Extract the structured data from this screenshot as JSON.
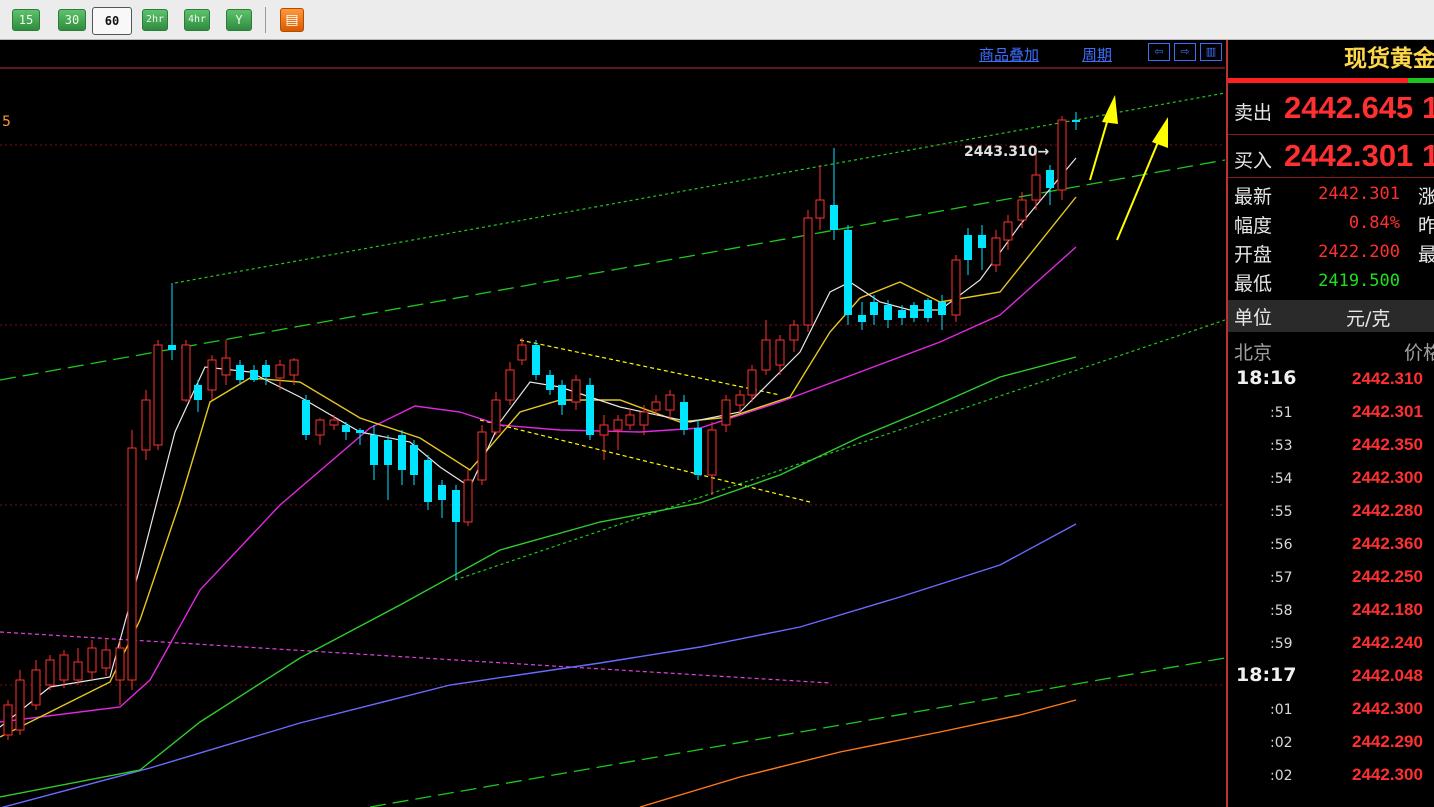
{
  "toolbar": {
    "buttons": [
      {
        "label": "15",
        "active": false
      },
      {
        "label": "30",
        "active": false
      },
      {
        "label": "60",
        "active": true
      },
      {
        "label": "2hr",
        "active": false
      },
      {
        "label": "4hr",
        "active": false
      },
      {
        "label": "Y",
        "active": false
      }
    ],
    "kline_icon": "k-chart-icon"
  },
  "chart": {
    "overlay_link": "商品叠加",
    "period_link": "周期",
    "nav_icons": [
      "arrow-left-icon",
      "arrow-right-icon",
      "panel-layout-icon"
    ],
    "ma_label": "5",
    "price_annotation": "2443.310→",
    "colors": {
      "up": "#ff3030",
      "down": "#00e5ff",
      "background": "#000000"
    }
  },
  "panel": {
    "title": "现货黄金",
    "sell_label": "卖出",
    "sell_price": "2442.645",
    "sell_extra": "1",
    "buy_label": "买入",
    "buy_price": "2442.301",
    "buy_extra": "1",
    "info": [
      {
        "label": "最新",
        "value": "2442.301",
        "color": "#ff3030",
        "label2": "涨"
      },
      {
        "label": "幅度",
        "value": "0.84%",
        "color": "#ff3030",
        "label2": "昨"
      },
      {
        "label": "开盘",
        "value": "2422.200",
        "color": "#ff3030",
        "label2": "最"
      },
      {
        "label": "最低",
        "value": "2419.500",
        "color": "#1ee01e",
        "label2": ""
      }
    ],
    "unit_label": "单位",
    "unit_value": "元/克",
    "city": "北京",
    "price_col": "价格",
    "ticks": [
      {
        "time": "18:16",
        "price": "2442.310",
        "big": true
      },
      {
        "time": ":51",
        "price": "2442.301",
        "big": false
      },
      {
        "time": ":53",
        "price": "2442.350",
        "big": false
      },
      {
        "time": ":54",
        "price": "2442.300",
        "big": false
      },
      {
        "time": ":55",
        "price": "2442.280",
        "big": false
      },
      {
        "time": ":56",
        "price": "2442.360",
        "big": false
      },
      {
        "time": ":57",
        "price": "2442.250",
        "big": false
      },
      {
        "time": ":58",
        "price": "2442.180",
        "big": false
      },
      {
        "time": ":59",
        "price": "2442.240",
        "big": false
      },
      {
        "time": "18:17",
        "price": "2442.048",
        "big": true
      },
      {
        "time": ":01",
        "price": "2442.300",
        "big": false
      },
      {
        "time": ":02",
        "price": "2442.290",
        "big": false
      },
      {
        "time": ":02",
        "price": "2442.300",
        "big": false
      }
    ]
  }
}
